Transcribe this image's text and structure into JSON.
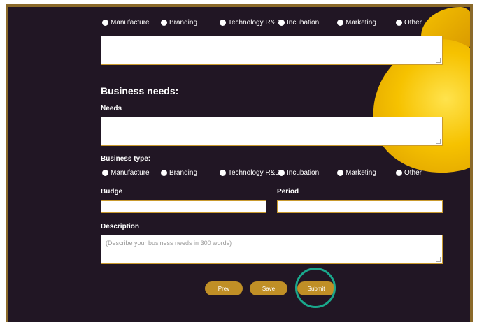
{
  "top_section": {
    "title_partial": "Business type:",
    "radios": [
      "Manufacture",
      "Branding",
      "Technology R&D",
      "Incubation",
      "Marketing",
      "Other"
    ]
  },
  "business_needs": {
    "title": "Business needs:",
    "needs_label": "Needs"
  },
  "business_type": {
    "label": "Business type:",
    "radios": [
      "Manufacture",
      "Branding",
      "Technology R&D",
      "Incubation",
      "Marketing",
      "Other"
    ]
  },
  "budge": {
    "label": "Budge"
  },
  "period": {
    "label": "Period"
  },
  "description": {
    "label": "Description",
    "placeholder": "(Describe your business needs in 300 words)"
  },
  "buttons": {
    "prev": "Prev",
    "save": "Save",
    "submit": "Submit"
  },
  "colors": {
    "panel_bg": "#211624",
    "button_bg": "#c08f26",
    "highlight_ring": "#1aa88c",
    "accent_blob": "#f6c200"
  }
}
